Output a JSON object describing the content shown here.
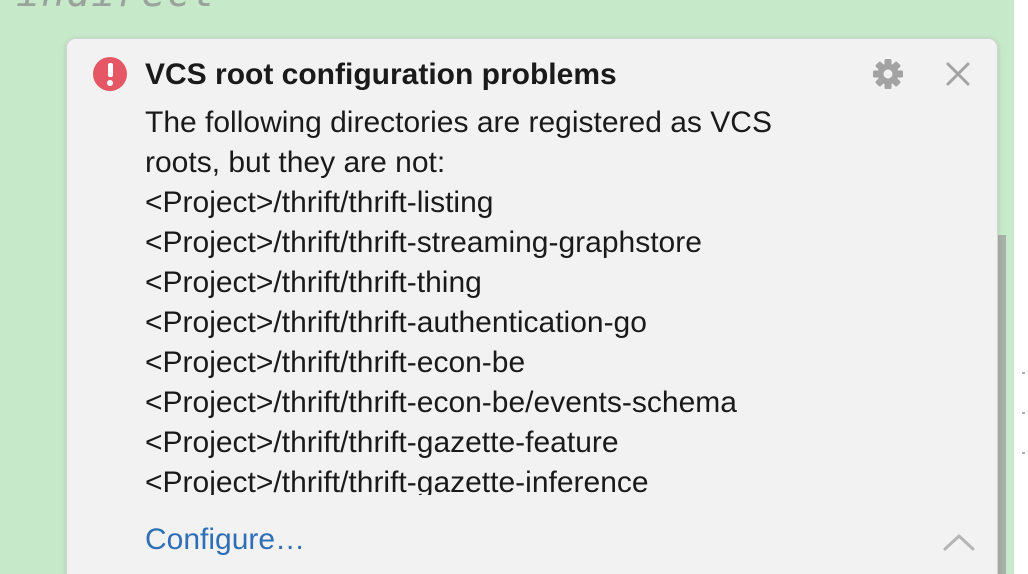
{
  "background": {
    "editor_text": "indirect",
    "editor_bg_color": "#c6eac9"
  },
  "notification": {
    "severity_icon": "error-icon",
    "severity_color": "#e55765",
    "title": "VCS root configuration problems",
    "body_intro_lines": [
      "The following directories are registered as VCS",
      "roots, but they are not:"
    ],
    "directories": [
      "<Project>/thrift/thrift-listing",
      "<Project>/thrift/thrift-streaming-graphstore",
      "<Project>/thrift/thrift-thing",
      "<Project>/thrift/thrift-authentication-go",
      "<Project>/thrift/thrift-econ-be",
      "<Project>/thrift/thrift-econ-be/events-schema",
      "<Project>/thrift/thrift-gazette-feature",
      "<Project>/thrift/thrift-gazette-inference"
    ],
    "action_label": "Configure…",
    "link_color": "#2f6fb5",
    "settings_icon": "gear-icon",
    "close_icon": "close-icon",
    "expand_icon": "chevron-up-icon"
  }
}
